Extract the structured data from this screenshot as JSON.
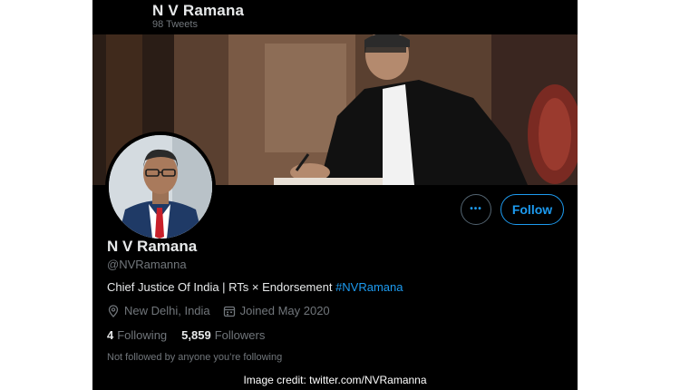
{
  "header": {
    "title": "N V Ramana",
    "tweet_count": "98 Tweets"
  },
  "actions": {
    "more_label": "•••",
    "follow_label": "Follow"
  },
  "profile": {
    "name": "N V Ramana",
    "handle": "@NVRamanna",
    "bio_text": "Chief Justice Of India | RTs × Endorsement ",
    "bio_hashtag": "#NVRamana",
    "location": "New Delhi, India",
    "joined": "Joined May 2020",
    "following_count": "4",
    "following_label": "Following",
    "followers_count": "5,859",
    "followers_label": "Followers",
    "follow_status": "Not followed by anyone you’re following"
  },
  "credit": "Image credit: twitter.com/NVRamanna",
  "colors": {
    "background": "#000000",
    "accent": "#1d9bf0",
    "primary_text": "#e7e9ea",
    "secondary_text": "#71767b"
  },
  "icons": {
    "location": "location-pin-icon",
    "joined": "calendar-icon",
    "more": "more-dots-icon"
  }
}
